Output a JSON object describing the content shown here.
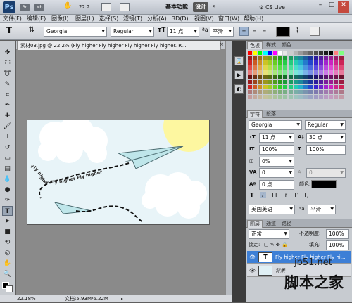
{
  "app": {
    "logo": "Ps",
    "zoom": "22.2",
    "workspace": "基本功能",
    "design": "设计",
    "search": "CS Live"
  },
  "menu": [
    "文件(F)",
    "编辑(E)",
    "图像(I)",
    "图层(L)",
    "选择(S)",
    "滤镜(T)",
    "分析(A)",
    "3D(D)",
    "视图(V)",
    "窗口(W)",
    "帮助(H)"
  ],
  "options": {
    "tool_icon": "T",
    "font_family": "Georgia",
    "font_style": "Regular",
    "font_size": "11 点",
    "antialias": "平滑"
  },
  "document": {
    "tab_title": "素材03.jpg @ 22.2% (Fly higher Fly higher Fly higher Fly higher. R...",
    "canvas_text": "Fly higher Fly higher Fly higher",
    "zoom_status": "22.18%",
    "doc_status": "文档:5.93M/6.22M"
  },
  "swatches_panel": {
    "tabs": [
      "色板",
      "样式",
      "颜色"
    ]
  },
  "char_panel": {
    "tabs": [
      "字符",
      "段落"
    ],
    "font_family": "Georgia",
    "font_style": "Regular",
    "size": "11 点",
    "leading": "30 点",
    "vscale": "100%",
    "hscale": "100%",
    "tracking": "0%",
    "kerning": "0",
    "kerning2": "0",
    "baseline": "0 点",
    "color_label": "颜色:",
    "language": "美国英语",
    "antialias": "平滑",
    "text_style_buttons": [
      "T",
      "T",
      "TT",
      "Tr",
      "T'",
      "T,",
      "T",
      "T"
    ]
  },
  "layers_panel": {
    "tabs": [
      "图层",
      "通道",
      "路径"
    ],
    "blend_mode": "正常",
    "opacity_label": "不透明度:",
    "opacity": "100%",
    "lock_label": "锁定:",
    "fill_label": "填充:",
    "fill": "100%",
    "layers": [
      {
        "name": "Fly higher Fly higher Fly hi...",
        "type": "T",
        "selected": true
      },
      {
        "name": "背景",
        "type": "image",
        "selected": false
      }
    ]
  },
  "watermark": {
    "domain": "jb51.net",
    "name": "脚本之家"
  },
  "colors": {
    "accent": "#3d7fd6",
    "sun": "#fdf7a0"
  }
}
